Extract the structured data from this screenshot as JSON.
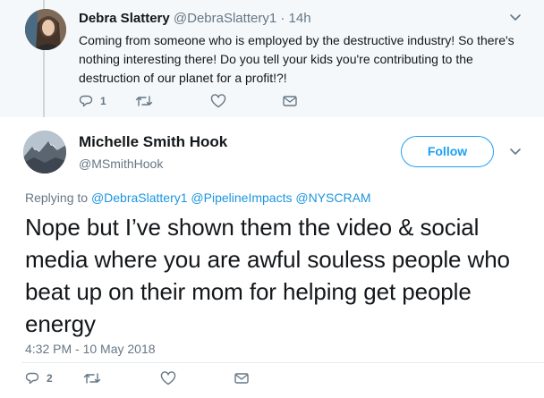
{
  "parent_tweet": {
    "name": "Debra Slattery",
    "handle": "@DebraSlattery1",
    "separator": "·",
    "time": "14h",
    "text": "Coming from someone who is employed by the destructive industry! So there's nothing interesting there! Do you tell your kids you're contributing to the destruction of our planet for a profit!?!",
    "reply_count": "1",
    "icons": [
      "reply-icon",
      "retweet-icon",
      "like-icon",
      "message-icon"
    ]
  },
  "main_tweet": {
    "name": "Michelle Smith Hook",
    "handle": "@MSmithHook",
    "follow_label": "Follow",
    "replying_prefix": "Replying to",
    "replying_to": [
      "@DebraSlattery1",
      "@PipelineImpacts",
      "@NYSCRAM"
    ],
    "text": "Nope but I’ve shown them the video & social media where you are awful souless people who beat up on their mom for helping get people energy",
    "timestamp": "4:32 PM - 10 May 2018",
    "reply_count": "2",
    "icons": [
      "reply-icon",
      "retweet-icon",
      "like-icon",
      "message-icon"
    ]
  },
  "colors": {
    "accent": "#1da1f2",
    "link": "#1b95e0",
    "muted": "#657786",
    "parent_bg": "#f5f8fa"
  }
}
